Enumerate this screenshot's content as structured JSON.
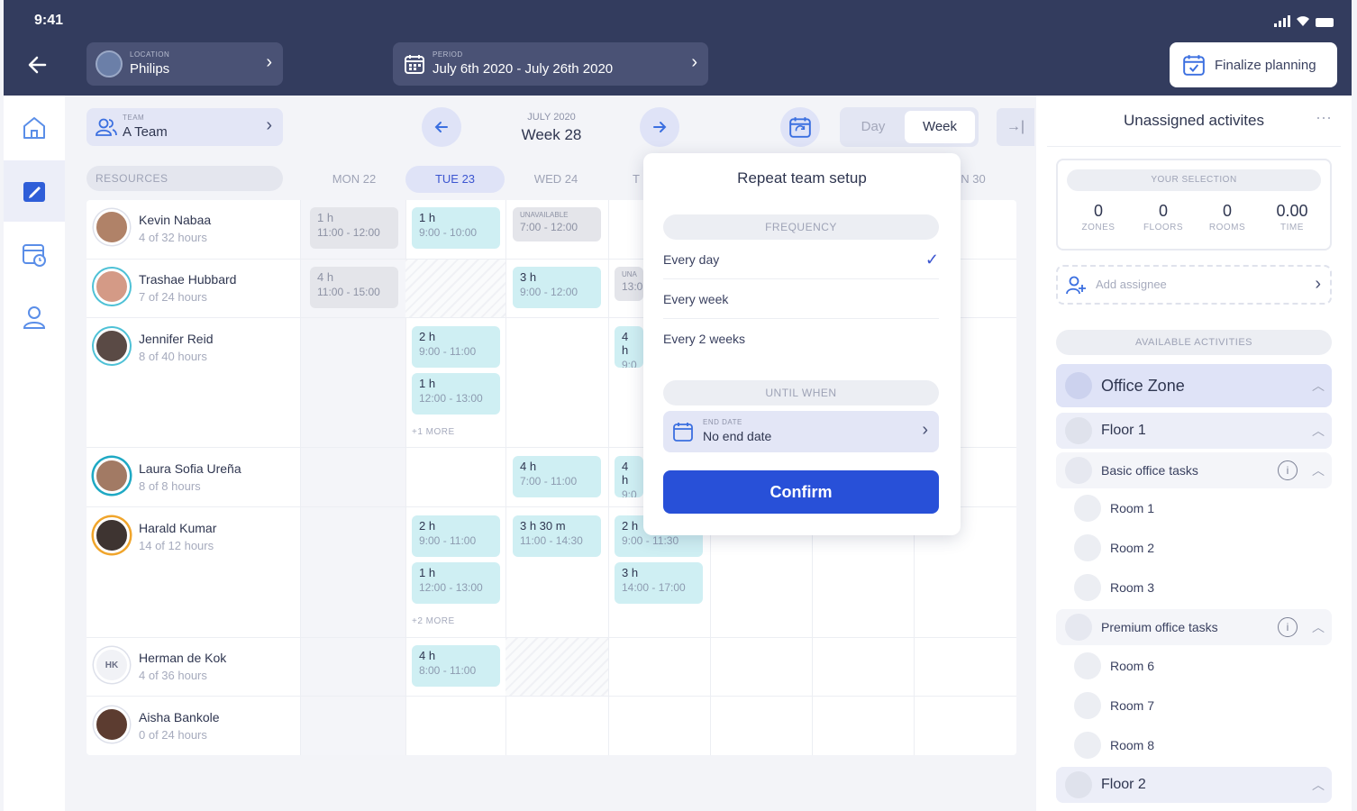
{
  "status": {
    "time": "9:41"
  },
  "header": {
    "location": {
      "label": "LOCATION",
      "value": "Philips"
    },
    "period": {
      "label": "PERIOD",
      "value": "July 6th 2020 - July 26th 2020"
    },
    "finalize_label": "Finalize planning"
  },
  "toolbar": {
    "team": {
      "label": "TEAM",
      "value": "A Team"
    },
    "week_sub": "JULY 2020",
    "week_main": "Week 28",
    "view_day": "Day",
    "view_week": "Week"
  },
  "grid": {
    "resources_header": "RESOURCES",
    "days": [
      "MON 22",
      "TUE 23",
      "WED 24",
      "T",
      "N 30"
    ],
    "people": [
      {
        "name": "Kevin Nabaa",
        "hours": "4 of 32 hours"
      },
      {
        "name": "Trashae Hubbard",
        "hours": "7 of 24 hours"
      },
      {
        "name": "Jennifer Reid",
        "hours": "8 of 40 hours"
      },
      {
        "name": "Laura Sofia Ureña",
        "hours": "8 of 8 hours"
      },
      {
        "name": "Harald Kumar",
        "hours": "14 of 12 hours"
      },
      {
        "name": "Herman de Kok",
        "hours": "4 of 36 hours",
        "initials": "HK"
      },
      {
        "name": "Aisha Bankole",
        "hours": "0 of 24 hours"
      }
    ],
    "blocks": [
      {
        "h": "1 h",
        "t": "11:00 - 12:00"
      },
      {
        "h": "1 h",
        "t": "9:00 - 10:00"
      },
      {
        "h": "UNAVAILABLE",
        "t": "7:00 - 12:00"
      },
      {
        "h": "4 h",
        "t": "11:00 - 15:00"
      },
      {
        "h": "3 h",
        "t": "9:00 - 12:00"
      },
      {
        "h": "UNA",
        "t": "13:0"
      },
      {
        "h": "2 h",
        "t": "9:00 - 11:00"
      },
      {
        "h": "1 h",
        "t": "12:00 - 13:00"
      },
      {
        "h": "4 h",
        "t": "9:0"
      },
      {
        "h": "4 h",
        "t": "7:00 - 11:00"
      },
      {
        "h": "4 h",
        "t": "9:0"
      },
      {
        "h": "2 h",
        "t": "9:00 - 11:00"
      },
      {
        "h": "3 h 30 m",
        "t": "11:00 - 14:30"
      },
      {
        "h": "2 h",
        "t": "9:00 - 11:30"
      },
      {
        "h": "1 h",
        "t": "12:00 - 13:00"
      },
      {
        "h": "3 h",
        "t": "14:00 - 17:00"
      },
      {
        "h": "4 h",
        "t": "8:00 - 11:00"
      }
    ],
    "more1": "+1 MORE",
    "more2": "+2 MORE"
  },
  "popup": {
    "title": "Repeat team setup",
    "frequency_label": "FREQUENCY",
    "options": [
      "Every day",
      "Every week",
      "Every 2 weeks"
    ],
    "until_label": "UNTIL WHEN",
    "end_date_label": "END DATE",
    "end_date_value": "No end date",
    "confirm_label": "Confirm"
  },
  "right_panel": {
    "title": "Unassigned activites",
    "your_selection": "YOUR SELECTION",
    "stats": [
      {
        "value": "0",
        "label": "ZONES"
      },
      {
        "value": "0",
        "label": "FLOORS"
      },
      {
        "value": "0",
        "label": "ROOMS"
      },
      {
        "value": "0.00",
        "label": "TIME"
      }
    ],
    "add_assignee": "Add assignee",
    "available_label": "AVAILABLE ACTIVITIES",
    "zone": "Office Zone",
    "floor1": "Floor 1",
    "group1": "Basic office tasks",
    "rooms1": [
      "Room 1",
      "Room 2",
      "Room 3"
    ],
    "group2": "Premium office tasks",
    "rooms2": [
      "Room 6",
      "Room 7",
      "Room 8"
    ],
    "floor2": "Floor 2"
  },
  "colors": {
    "header": "#333c5e",
    "accent": "#2850d8",
    "block": "#cfeff3"
  }
}
